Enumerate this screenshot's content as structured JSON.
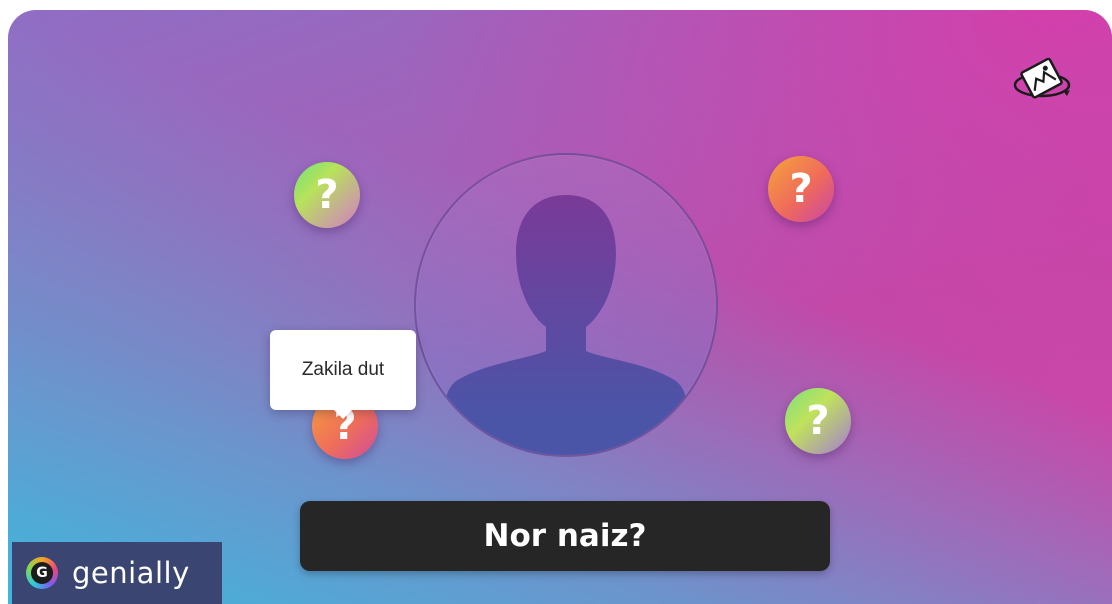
{
  "slide": {
    "tooltip_text": "Zakila dut",
    "question_mark": "?",
    "name_bar_label": "Nor naiz?"
  },
  "brand": {
    "name": "genially",
    "logo_letter": "G"
  },
  "icons": {
    "top_right": "360-view-icon",
    "portrait": "person-silhouette-icon"
  },
  "colors": {
    "name_bar_bg": "#262626",
    "brand_bg": "#3a4572",
    "tooltip_bg": "#ffffff"
  }
}
